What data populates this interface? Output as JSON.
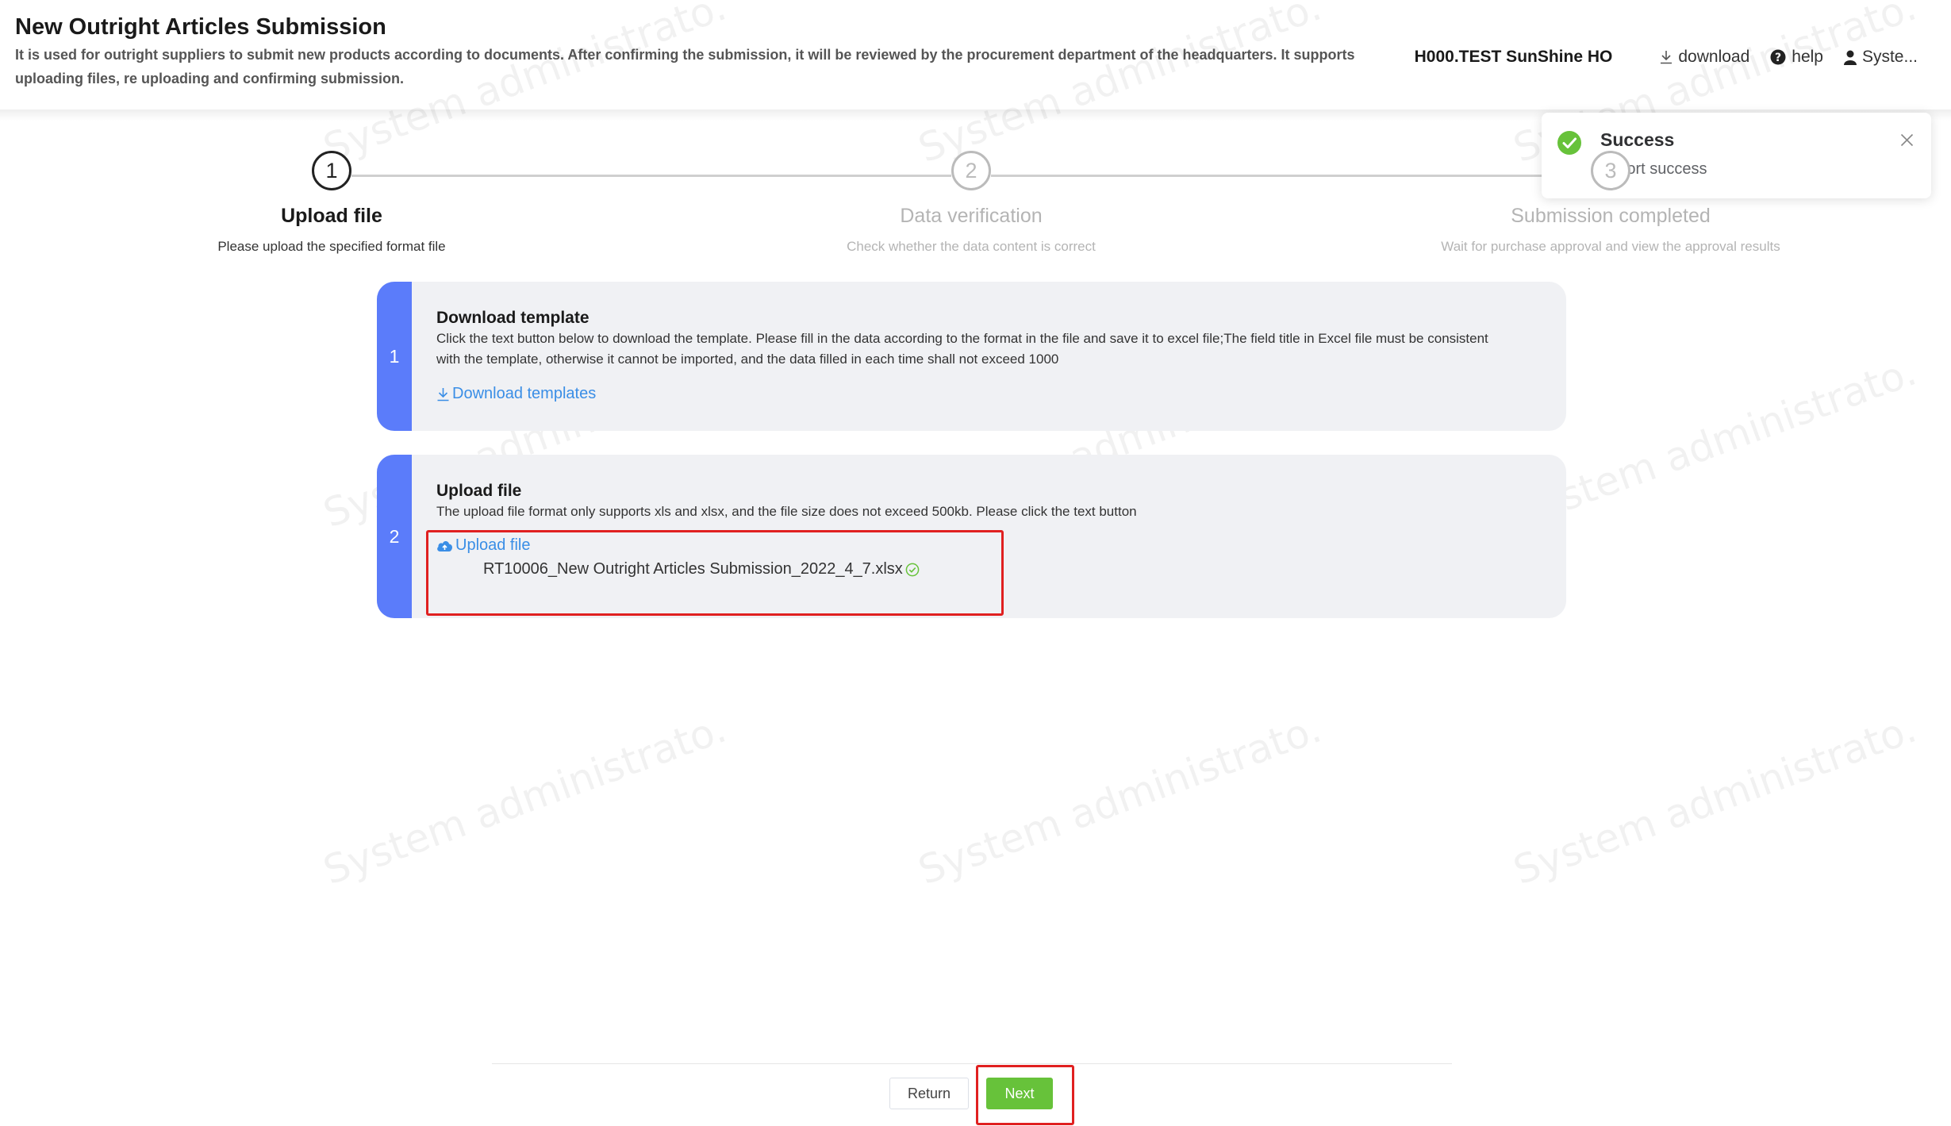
{
  "header": {
    "title": "New Outright Articles Submission",
    "description": "It is used for outright suppliers to submit new products according to documents. After confirming the submission, it will be reviewed by the procurement department of the headquarters. It supports uploading files, re uploading and confirming submission.",
    "org_name": "H000.TEST SunShine HO",
    "download_label": "download",
    "help_label": "help",
    "user_label": "Syste..."
  },
  "watermark_text": "System administrato.",
  "steps": [
    {
      "number": "1",
      "title": "Upload file",
      "description": "Please upload the specified format file",
      "active": true
    },
    {
      "number": "2",
      "title": "Data verification",
      "description": "Check whether the data content is correct",
      "active": false
    },
    {
      "number": "3",
      "title": "Submission completed",
      "description": "Wait for purchase approval and view the approval results",
      "active": false
    }
  ],
  "download_card": {
    "number": "1",
    "title": "Download template",
    "text": "Click the text button below to download the template. Please fill in the data according to the format in the file and save it to excel file;The field title in Excel file must be consistent with the template, otherwise it cannot be imported, and the data filled in each time shall not exceed 1000",
    "link_label": "Download templates"
  },
  "upload_card": {
    "number": "2",
    "title": "Upload file",
    "text": "The upload file format only supports xls and xlsx, and the file size does not exceed 500kb. Please click the text button",
    "link_label": "Upload file",
    "file_name": "RT10006_New Outright Articles Submission_2022_4_7.xlsx"
  },
  "footer": {
    "return_label": "Return",
    "next_label": "Next"
  },
  "toast": {
    "title": "Success",
    "message": "Import success"
  },
  "colors": {
    "accent": "#5b7cfa",
    "link": "#3a8ee6",
    "success": "#67c23a",
    "highlight": "#e02020"
  }
}
